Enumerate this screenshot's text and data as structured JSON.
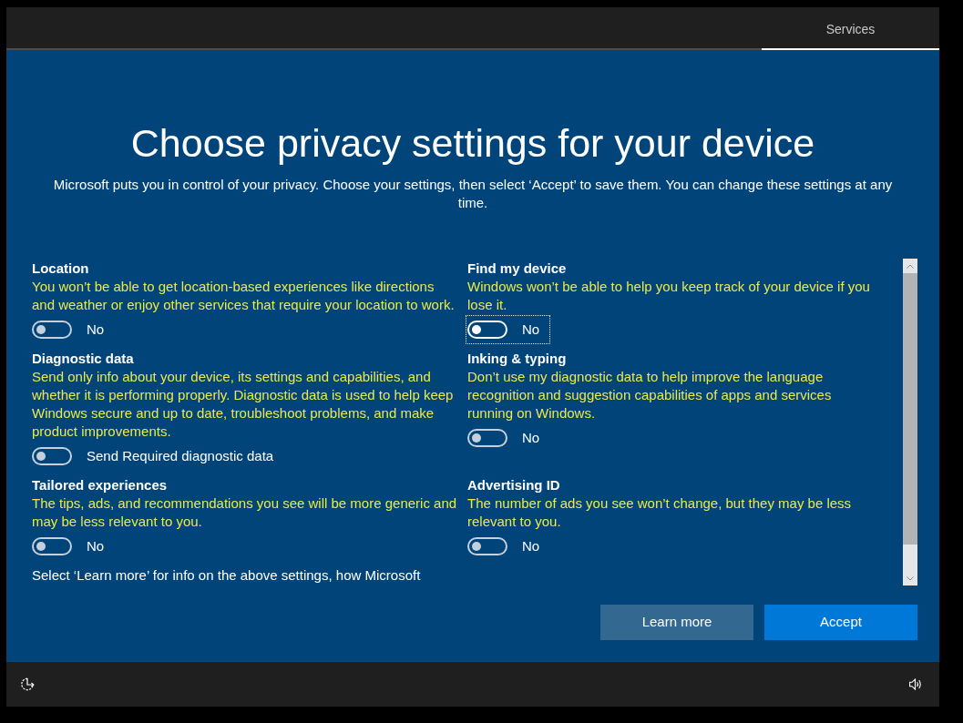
{
  "top_bar": {
    "steps": [
      {
        "label": "Services",
        "selected": true
      }
    ]
  },
  "heading": {
    "title": "Choose privacy settings for your device",
    "subtitle": "Microsoft puts you in control of your privacy. Choose your settings, then select ‘Accept’ to save them. You can change these settings at any time."
  },
  "settings": [
    {
      "title": "Location",
      "description": "You won’t be able to get location-based experiences like directions and weather or enjoy other services that require your location to work.",
      "toggle_label": "No",
      "on": false,
      "focused": false
    },
    {
      "title": "Find my device",
      "description": "Windows won’t be able to help you keep track of your device if you lose it.",
      "toggle_label": "No",
      "on": false,
      "focused": true
    },
    {
      "title": "Diagnostic data",
      "description": "Send only info about your device, its settings and capabilities, and whether it is performing properly. Diagnostic data is used to help keep Windows secure and up to date, troubleshoot problems, and make product improvements.",
      "toggle_label": "Send Required diagnostic data",
      "on": false,
      "focused": false
    },
    {
      "title": "Inking & typing",
      "description": "Don’t use my diagnostic data to help improve the language recognition and suggestion capabilities of apps and services running on Windows.",
      "toggle_label": "No",
      "on": false,
      "focused": false
    },
    {
      "title": "Tailored experiences",
      "description": "The tips, ads, and recommendations you see will be more generic and may be less relevant to you.",
      "toggle_label": "No",
      "on": false,
      "focused": false
    },
    {
      "title": "Advertising ID",
      "description": "The number of ads you see won’t change, but they may be less relevant to you.",
      "toggle_label": "No",
      "on": false,
      "focused": false
    }
  ],
  "footnote": "Select ‘Learn more’ for info on the above settings, how Microsoft",
  "buttons": [
    {
      "label": "Learn more",
      "kind": "secondary"
    },
    {
      "label": "Accept",
      "kind": "primary"
    }
  ]
}
